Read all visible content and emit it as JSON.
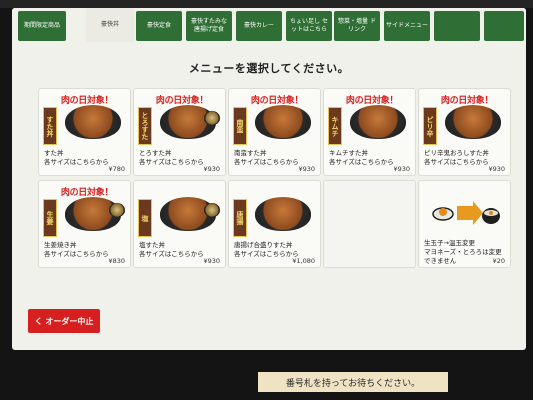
{
  "tabs": [
    {
      "label": "期間限定商品",
      "active": false
    },
    {
      "label": "豪快丼",
      "active": true
    },
    {
      "label": "豪快定食",
      "active": false
    },
    {
      "label": "豪快すたみな\n唐揚げ定食",
      "active": false
    },
    {
      "label": "豪快カレー",
      "active": false
    },
    {
      "label": "ちょい足し\nセットはこちら",
      "active": false
    },
    {
      "label": "惣菜・増量\nドリンク",
      "active": false
    },
    {
      "label": "サイドメニュー",
      "active": false
    },
    {
      "label": "",
      "active": false
    },
    {
      "label": "",
      "active": false
    }
  ],
  "heading": "メニューを選択してください。",
  "menu": [
    {
      "badge": "肉の日対象！",
      "label": "すた丼",
      "desc": "すた丼\n各サイズはこちらから",
      "price": "¥780"
    },
    {
      "badge": "肉の日対象！",
      "label": "とろすた",
      "desc": "とろすた丼\n各サイズはこちらから",
      "price": "¥930"
    },
    {
      "badge": "肉の日対象！",
      "label": "南蛮",
      "desc": "南蛮すた丼\n各サイズはこちらから",
      "price": "¥930"
    },
    {
      "badge": "肉の日対象！",
      "label": "キムチ",
      "desc": "キムチすた丼\n各サイズはこちらから",
      "price": "¥930"
    },
    {
      "badge": "肉の日対象！",
      "label": "ピリ辛",
      "desc": "ピリ辛鬼おろしすた丼\n各サイズはこちらから",
      "price": "¥930"
    },
    {
      "badge": "肉の日対象！",
      "label": "生姜",
      "desc": "生姜焼き丼\n各サイズはこちらから",
      "price": "¥830"
    },
    {
      "badge": "",
      "label": "塩",
      "desc": "塩すた丼\n各サイズはこちらから",
      "price": "¥930"
    },
    {
      "badge": "",
      "label": "唐揚",
      "desc": "唐揚げ合盛りすた丼\n各サイズはこちらから",
      "price": "¥1,080"
    },
    {
      "badge": "",
      "label": "",
      "desc": "",
      "price": ""
    },
    {
      "badge": "",
      "label": "",
      "desc": "生玉子→温玉変更\nマヨネーズ・とろろは変更\nできません",
      "price": "¥20"
    }
  ],
  "cancel_label": "く オーダー中止",
  "banner": "番号札を持ってお待ちください。",
  "colors": {
    "tab": "#2f6e34",
    "cancel": "#d71f1f",
    "badge": "#d81e1e"
  }
}
